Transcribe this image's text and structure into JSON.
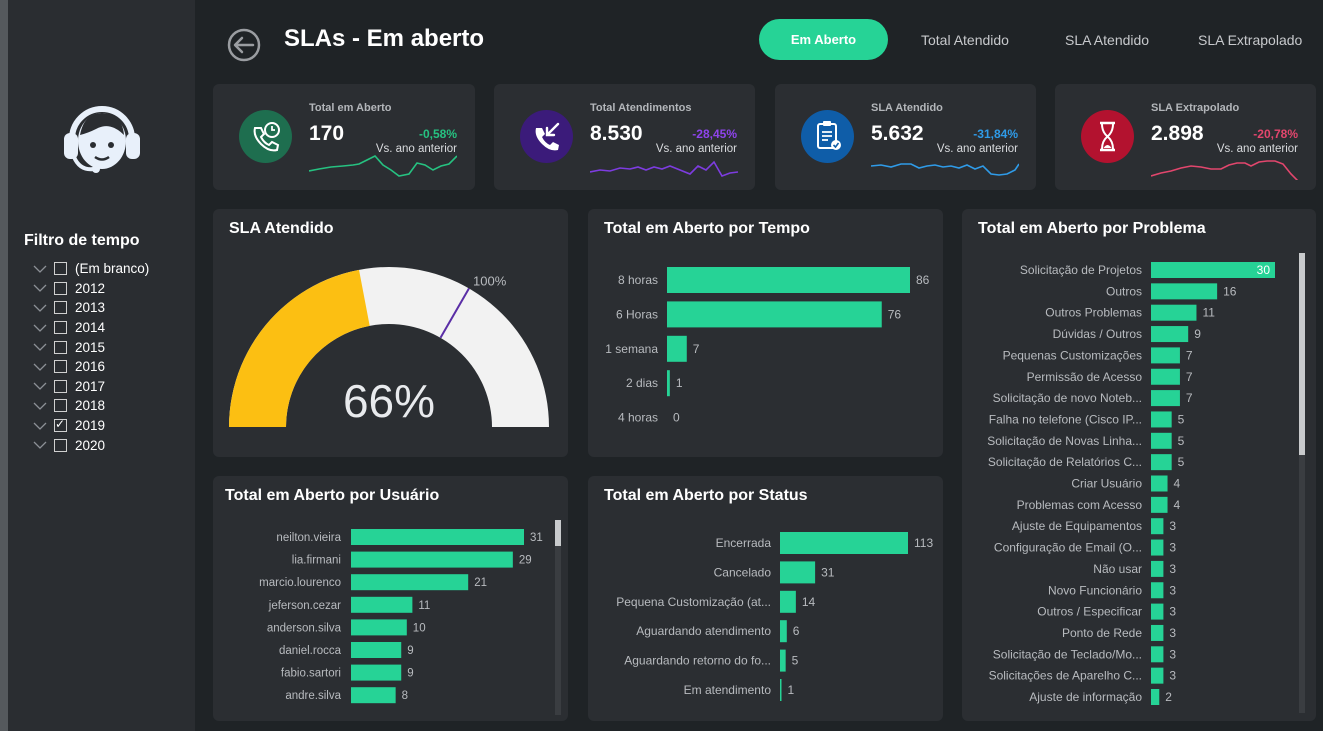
{
  "header": {
    "title": "SLAs - Em aberto",
    "nav": [
      "Em Aberto",
      "Total Atendido",
      "SLA Atendido",
      "SLA Extrapolado"
    ],
    "active_nav": "Em Aberto"
  },
  "sidebar": {
    "filter_title": "Filtro de tempo",
    "items": [
      {
        "label": "(Em branco)",
        "checked": false
      },
      {
        "label": "2012",
        "checked": false
      },
      {
        "label": "2013",
        "checked": false
      },
      {
        "label": "2014",
        "checked": false
      },
      {
        "label": "2015",
        "checked": false
      },
      {
        "label": "2016",
        "checked": false
      },
      {
        "label": "2017",
        "checked": false
      },
      {
        "label": "2018",
        "checked": false
      },
      {
        "label": "2019",
        "checked": true
      },
      {
        "label": "2020",
        "checked": false
      }
    ]
  },
  "kpis": [
    {
      "label": "Total em Aberto",
      "value": "170",
      "delta": "-0,58%",
      "vs": "Vs. ano anterior",
      "color": "#26c281",
      "icon": "phone-clock-icon",
      "icon_bg": "#1e6e4f"
    },
    {
      "label": "Total Atendimentos",
      "value": "8.530",
      "delta": "-28,45%",
      "vs": "Vs. ano anterior",
      "color": "#8e44ec",
      "icon": "phone-incoming-icon",
      "icon_bg": "#3b1b7a"
    },
    {
      "label": "SLA Atendido",
      "value": "5.632",
      "delta": "-31,84%",
      "vs": "Vs. ano anterior",
      "color": "#2f9be8",
      "icon": "clipboard-check-icon",
      "icon_bg": "#0f5da8"
    },
    {
      "label": "SLA Extrapolado",
      "value": "2.898",
      "delta": "-20,78%",
      "vs": "Vs. ano anterior",
      "color": "#e2466d",
      "icon": "hourglass-icon",
      "icon_bg": "#b3122f"
    }
  ],
  "colors": {
    "bar": "#26d396",
    "gauge_fill": "#fcbf12",
    "gauge_bg": "#f2f2f2",
    "target": "#5a2ea6"
  },
  "chart_data": [
    {
      "type": "gauge",
      "title": "SLA Atendido",
      "value": 66,
      "value_label": "66%",
      "target": 100,
      "target_label": "100%",
      "min": 0,
      "max": 150
    },
    {
      "type": "bar",
      "orientation": "horizontal",
      "title": "Total em Aberto por Tempo",
      "categories": [
        "8 horas",
        "6 Horas",
        "1 semana",
        "2 dias",
        "4 horas"
      ],
      "values": [
        86,
        76,
        7,
        1,
        0
      ]
    },
    {
      "type": "bar",
      "orientation": "horizontal",
      "title": "Total em Aberto por Problema",
      "categories": [
        "Solicitação de Projetos",
        "Outros",
        "Outros Problemas",
        "Dúvidas / Outros",
        "Pequenas Customizações",
        "Permissão de Acesso",
        "Solicitação de novo Noteb...",
        "Falha no telefone (Cisco IP...",
        "Solicitação de Novas Linha...",
        "Solicitação de Relatórios C...",
        "Criar Usuário",
        "Problemas com Acesso",
        "Ajuste de Equipamentos",
        "Configuração de Email (O...",
        "Não usar",
        "Novo Funcionário",
        "Outros / Especificar",
        "Ponto de Rede",
        "Solicitação de Teclado/Mo...",
        "Solicitações de Aparelho C...",
        "Ajuste de informação"
      ],
      "values": [
        30,
        16,
        11,
        9,
        7,
        7,
        7,
        5,
        5,
        5,
        4,
        4,
        3,
        3,
        3,
        3,
        3,
        3,
        3,
        3,
        2
      ]
    },
    {
      "type": "bar",
      "orientation": "horizontal",
      "title": "Total em Aberto por Usuário",
      "categories": [
        "neilton.vieira",
        "lia.firmani",
        "marcio.lourenco",
        "jeferson.cezar",
        "anderson.silva",
        "daniel.rocca",
        "fabio.sartori",
        "andre.silva"
      ],
      "values": [
        31,
        29,
        21,
        11,
        10,
        9,
        9,
        8
      ]
    },
    {
      "type": "bar",
      "orientation": "horizontal",
      "title": "Total em Aberto por Status",
      "categories": [
        "Encerrada",
        "Cancelado",
        "Pequena Customização (at...",
        "Aguardando atendimento",
        "Aguardando retorno do fo...",
        "Em atendimento"
      ],
      "values": [
        113,
        31,
        14,
        6,
        5,
        1
      ]
    }
  ]
}
